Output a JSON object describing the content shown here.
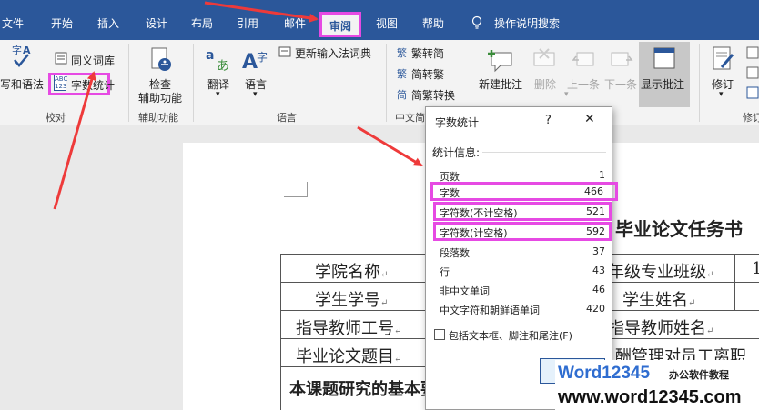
{
  "ribbon_tabs": [
    "文件",
    "开始",
    "插入",
    "设计",
    "布局",
    "引用",
    "邮件",
    "审阅",
    "视图",
    "帮助"
  ],
  "tell_me": "操作说明搜索",
  "proofing": {
    "spelling_partial": "拼写和语法",
    "thesaurus": "同义词库",
    "word_count": "字数统计",
    "word_count_icon": "ABC 123",
    "group": "校对"
  },
  "accessibility": {
    "check_line1": "检查",
    "check_line2": "辅助功能",
    "group": "辅助功能"
  },
  "language": {
    "translate": "翻译",
    "language": "语言",
    "update_ime": "更新输入法词典",
    "group": "语言"
  },
  "chinese_conversion": {
    "trad": "繁转简",
    "simp": "简转繁",
    "convert": "简繁转换",
    "group_partial": "中文简"
  },
  "comments": {
    "new": "新建批注",
    "delete": "删除",
    "prev": "上一条",
    "next": "下一条",
    "show": "显示批注"
  },
  "tracking": {
    "track": "修订",
    "group_partial": "修订"
  },
  "document": {
    "heading_partial": "毕业论文任务书",
    "rows": [
      [
        "学院名称",
        "年级专业班级",
        "1"
      ],
      [
        "学生学号",
        "学生姓名"
      ],
      [
        "指导教师工号",
        "指导教师姓名"
      ],
      [
        "毕业论文题目",
        "酬管理对员工离职"
      ]
    ],
    "section_partial": "本课题研究的基本要求"
  },
  "dialog": {
    "title": "字数统计",
    "help": "?",
    "close": "✕",
    "stats_label": "统计信息:",
    "stats": [
      {
        "label": "页数",
        "value": "1"
      },
      {
        "label": "字数",
        "value": "466"
      },
      {
        "label": "字符数(不计空格)",
        "value": "521"
      },
      {
        "label": "字符数(计空格)",
        "value": "592"
      },
      {
        "label": "段落数",
        "value": "37"
      },
      {
        "label": "行",
        "value": "43"
      },
      {
        "label": "非中文单词",
        "value": "46"
      },
      {
        "label": "中文字符和朝鲜语单词",
        "value": "420"
      }
    ],
    "checkbox_label": "包括文本框、脚注和尾注(F)"
  },
  "watermark": {
    "logo": "Word12345",
    "sub": "办公软件教程",
    "url": "www.word12345.com"
  },
  "colors": {
    "ribbon_blue": "#2b579a",
    "highlight": "#e64ae3",
    "arrow": "#ee3a3a"
  }
}
